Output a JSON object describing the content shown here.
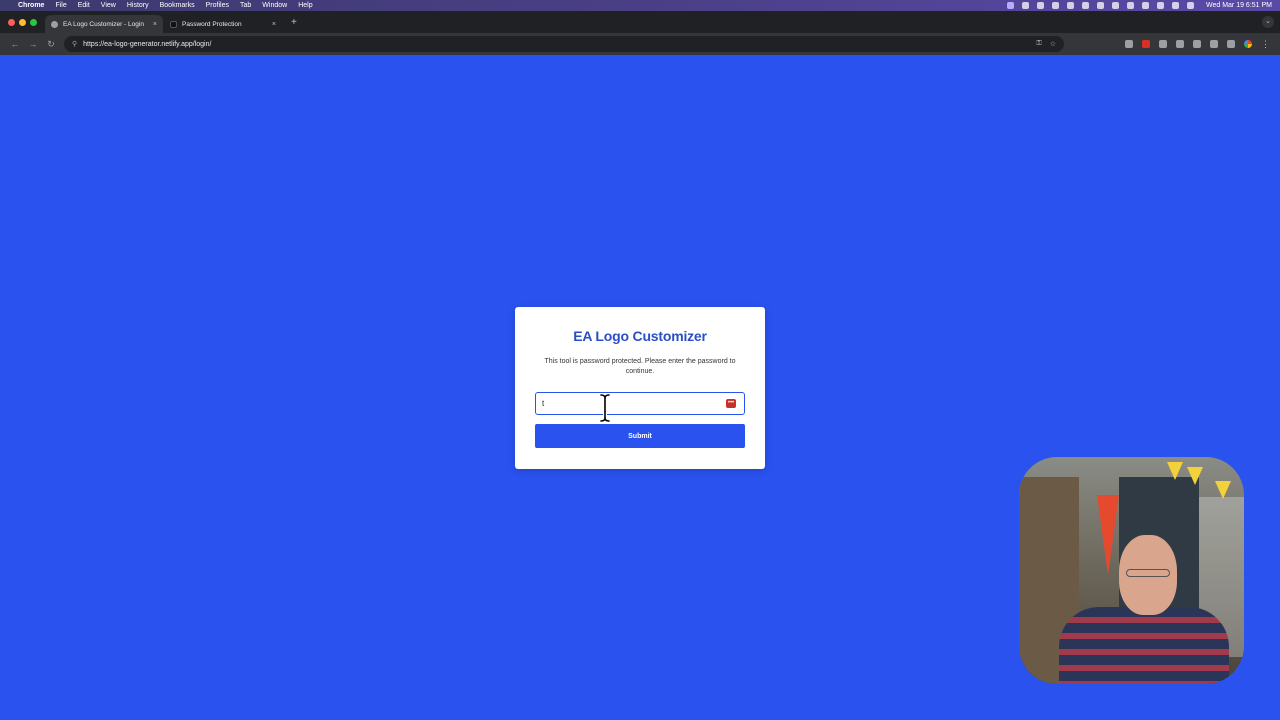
{
  "menubar": {
    "app_name": "Chrome",
    "items": [
      "File",
      "Edit",
      "View",
      "History",
      "Bookmarks",
      "Profiles",
      "Tab",
      "Window",
      "Help"
    ],
    "clock": "Wed Mar 19  6:51 PM"
  },
  "tabs": [
    {
      "label": "EA Logo Customizer - Login",
      "close": "×"
    },
    {
      "label": "Password Protection",
      "close": "×"
    }
  ],
  "toolbar": {
    "url": "https://ea-logo-generator.netlify.app/login/"
  },
  "login": {
    "title": "EA Logo Customizer",
    "description": "This tool is password protected. Please enter the password to continue.",
    "password_value": "t",
    "pw_manager_glyph": "•••",
    "submit_label": "Submit"
  },
  "colors": {
    "page_background": "#2952ee",
    "title": "#2b4fc4",
    "button": "#2952ee"
  }
}
